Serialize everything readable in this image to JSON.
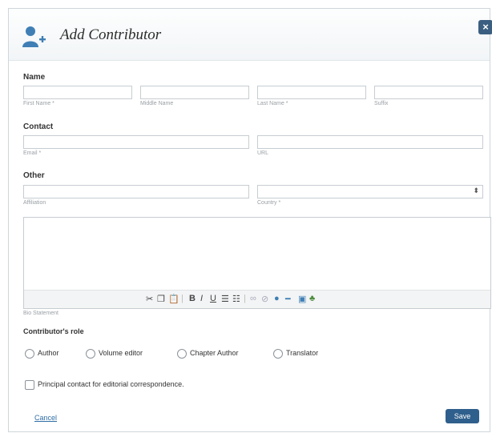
{
  "dialog": {
    "title": "Add Contributor",
    "close_label": "×"
  },
  "name_section": {
    "heading": "Name",
    "first_name_hint": "First Name *",
    "middle_name_hint": "Middle Name",
    "last_name_hint": "Last Name *",
    "suffix_hint": "Suffix"
  },
  "contact_section": {
    "heading": "Contact",
    "email_hint": "Email *",
    "url_hint": "URL"
  },
  "other_section": {
    "heading": "Other",
    "affiliation_hint": "Affiliation",
    "country_hint": "Country *",
    "country_value": ""
  },
  "bio": {
    "hint": "Bio Statement"
  },
  "role": {
    "heading": "Contributor's role",
    "options": [
      "Author",
      "Volume editor",
      "Chapter Author",
      "Translator"
    ]
  },
  "principal_contact": {
    "label": "Principal contact for editorial correspondence."
  },
  "footer": {
    "cancel_label": "Cancel",
    "save_label": "Save"
  },
  "icons": {
    "title_icon": "add-user-icon",
    "close_icon": "close-icon",
    "select_arrow": "up-down-arrow-icon"
  }
}
